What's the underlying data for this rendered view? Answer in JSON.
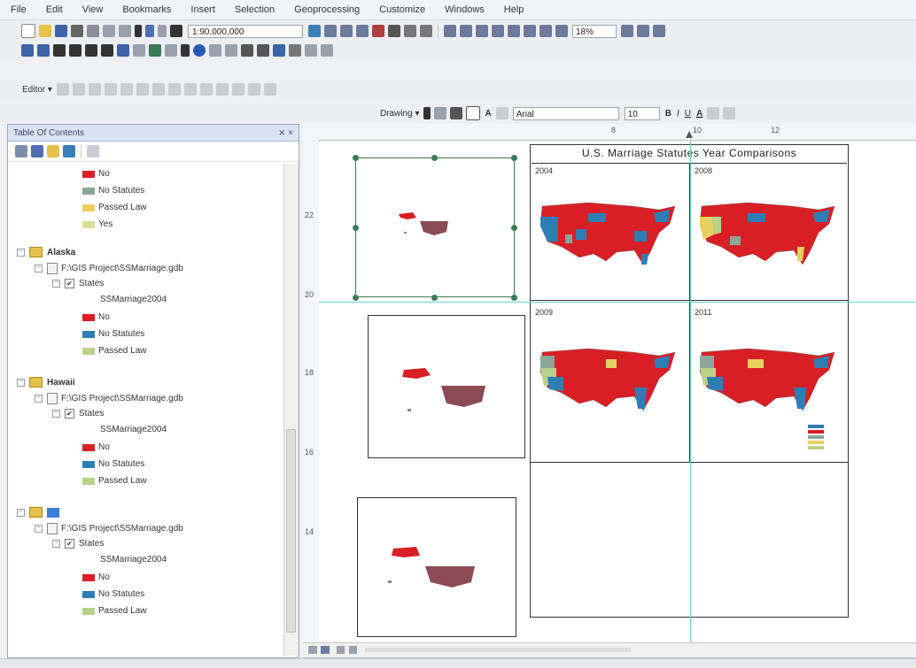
{
  "menu": [
    "File",
    "Edit",
    "View",
    "Bookmarks",
    "Insert",
    "Selection",
    "Geoprocessing",
    "Customize",
    "Windows",
    "Help"
  ],
  "toolbar": {
    "scale": "1:90,000,000",
    "zoom": "18%",
    "editor_label": "Editor ▾",
    "drawing_label": "Drawing ▾",
    "font_name": "Arial",
    "font_size": "10",
    "bold": "B",
    "italic": "I",
    "underline": "U",
    "font_color": "A"
  },
  "toc": {
    "title": "Table Of Contents",
    "close": "⨯ ×",
    "top_items": [
      {
        "label": "No",
        "color": "#d81f26"
      },
      {
        "label": "No Statutes",
        "color": "#8aa79a"
      },
      {
        "label": "Passed Law",
        "color": "#e8d060"
      },
      {
        "label": "Yes",
        "color": "#d8df9a"
      }
    ],
    "groups": [
      {
        "name": "Alaska",
        "db": "F:\\GIS Project\\SSMarriage.gdb",
        "layer": "States",
        "field": "SSMarriage2004",
        "items": [
          {
            "label": "No",
            "color": "#d81f26"
          },
          {
            "label": "No Statutes",
            "color": "#2e7eb5"
          },
          {
            "label": "Passed Law",
            "color": "#b9d18a"
          }
        ]
      },
      {
        "name": "Hawaii",
        "db": "F:\\GIS Project\\SSMarriage.gdb",
        "layer": "States",
        "field": "SSMarriage2004",
        "items": [
          {
            "label": "No",
            "color": "#d81f26"
          },
          {
            "label": "No Statutes",
            "color": "#2e7eb5"
          },
          {
            "label": "Passed Law",
            "color": "#b9d18a"
          }
        ]
      },
      {
        "name": "",
        "db": "F:\\GIS Project\\SSMarriage.gdb",
        "layer": "States",
        "field": "SSMarriage2004",
        "items": [
          {
            "label": "No",
            "color": "#d81f26"
          },
          {
            "label": "No Statutes",
            "color": "#2e7eb5"
          },
          {
            "label": "Passed Law",
            "color": "#b9d18a"
          }
        ]
      }
    ]
  },
  "layout": {
    "title": "U.S. Marriage Statutes Year Comparisons",
    "years": [
      "2004",
      "2008",
      "2009",
      "2011"
    ],
    "ruler_top": [
      "8",
      "10",
      "12"
    ],
    "ruler_left": [
      "22",
      "20",
      "18",
      "16",
      "14"
    ]
  },
  "colors": {
    "red": "#d81f26",
    "blue": "#2e7eb5",
    "teal": "#8aa79a",
    "yellow": "#e8d060",
    "green": "#b9d18a",
    "selection": "#3b7a56",
    "guide": "#6fd0d8"
  }
}
